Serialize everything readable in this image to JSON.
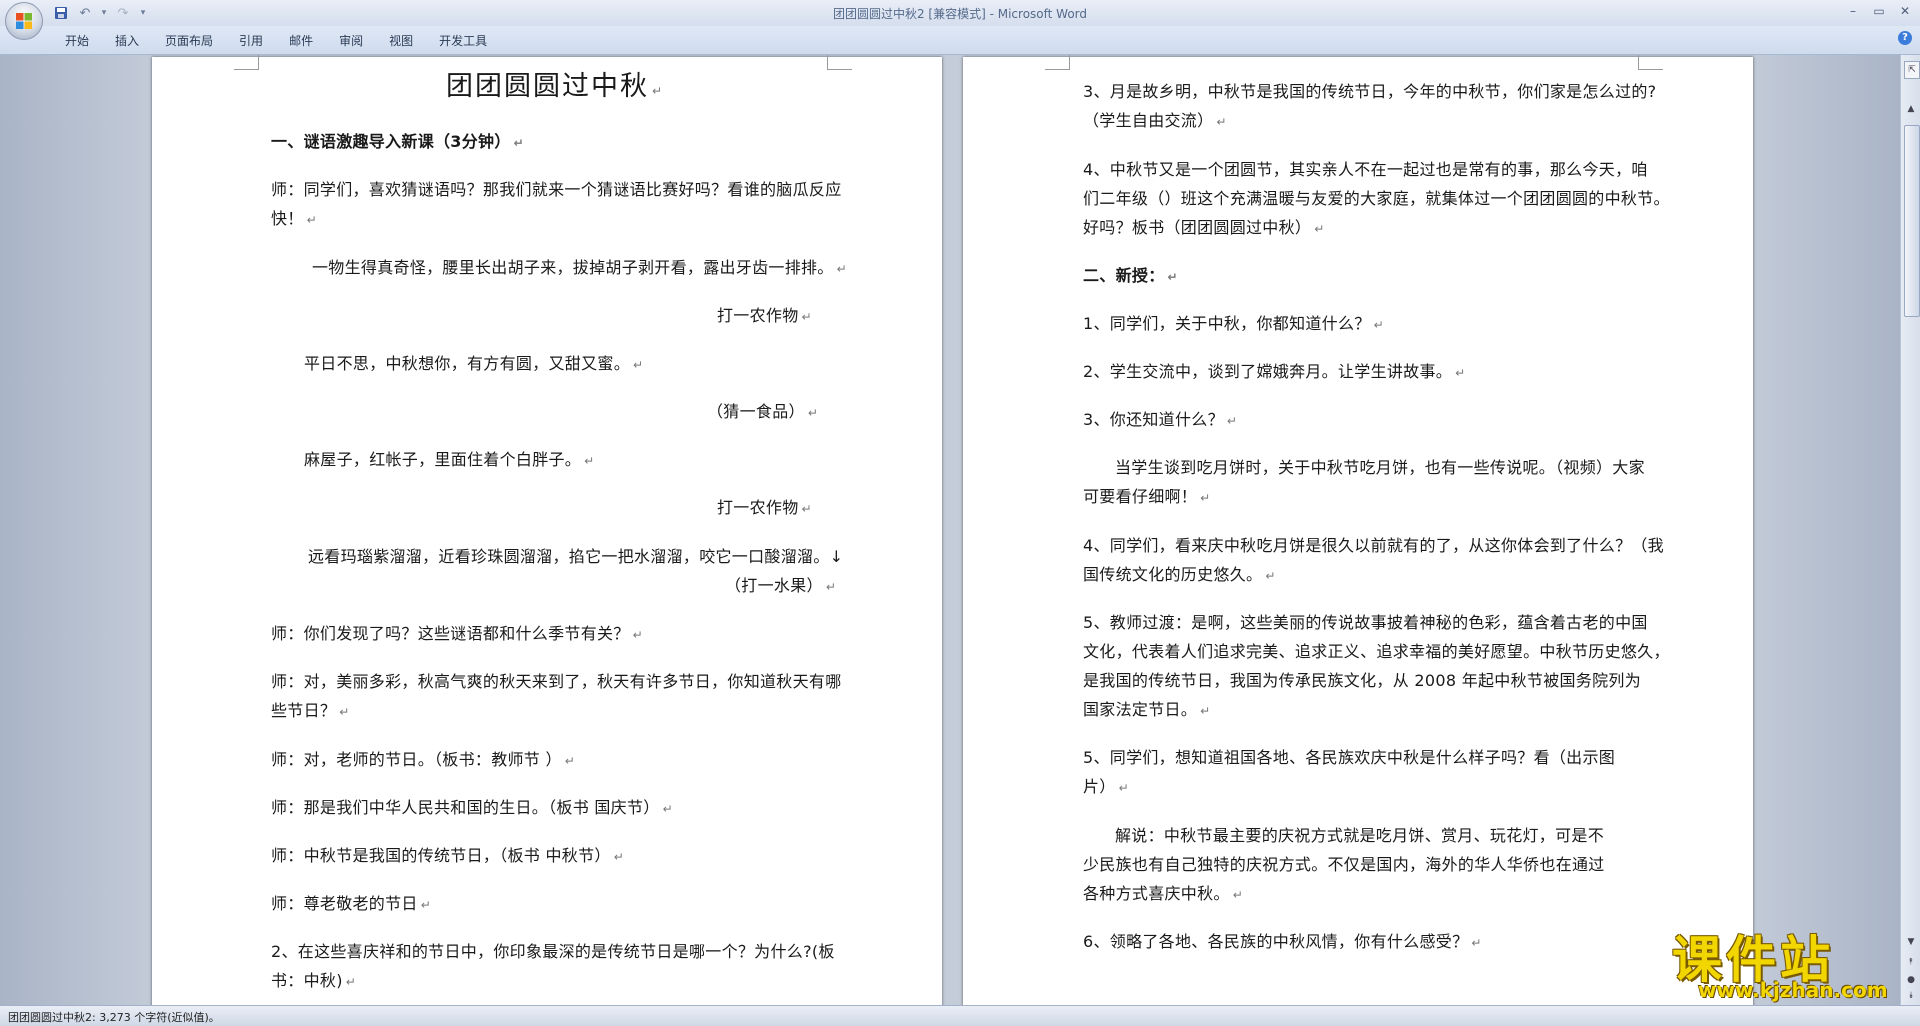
{
  "window": {
    "title": "团团圆圆过中秋2 [兼容模式] - Microsoft Word",
    "controls": {
      "minimize": "–",
      "maximize": "▭",
      "close": "✕"
    }
  },
  "quick_access": {
    "save_icon": "💾",
    "undo_icon": "↶",
    "undo_arrow": "▾",
    "redo_icon": "↷",
    "customize_icon": "▾"
  },
  "ribbon": {
    "tabs": [
      "开始",
      "插入",
      "页面布局",
      "引用",
      "邮件",
      "审阅",
      "视图",
      "开发工具"
    ],
    "help_icon": "?"
  },
  "document": {
    "page1": {
      "title": "团团圆圆过中秋",
      "paragraphs": [
        "一、谜语激趣导入新课（3分钟）",
        "师：同学们，喜欢猜谜语吗？那我们就来一个猜谜语比赛好吗？看谁的脑瓜反应",
        "快！",
        "一物生得真奇怪，腰里长出胡子来，拔掉胡子剥开看，露出牙齿一排排。",
        "打一农作物",
        "平日不思，中秋想你，有方有圆，又甜又蜜。",
        "（猜一食品）",
        "麻屋子，红帐子，里面住着个白胖子。",
        "打一农作物",
        "远看玛瑙紫溜溜，近看珍珠圆溜溜，掐它一把水溜溜，咬它一口酸溜溜。↓",
        "（打一水果）",
        "师：你们发现了吗？这些谜语都和什么季节有关？",
        "师：对，美丽多彩，秋高气爽的秋天来到了，秋天有许多节日，你知道秋天有哪",
        "些节日？",
        "师：对，老师的节日。（板书：教师节 ）",
        "师：那是我们中华人民共和国的生日。（板书    国庆节）",
        "师：中秋节是我国的传统节日，（板书 中秋节）",
        "师：尊老敬老的节日",
        "2、在这些喜庆祥和的节日中，你印象最深的是传统节日是哪一个？为什么?(板",
        "书：中秋)"
      ]
    },
    "page2": {
      "paragraphs": [
        "3、月是故乡明，中秋节是我国的传统节日，今年的中秋节，你们家是怎么过的?",
        "（学生自由交流）",
        "4、中秋节又是一个团圆节，其实亲人不在一起过也是常有的事，那么今天，咱",
        "们二年级（）班这个充满温暖与友爱的大家庭，就集体过一个团团圆圆的中秋节。",
        "好吗？板书（团团圆圆过中秋）",
        "二、新授：",
        "1、同学们，关于中秋，你都知道什么？",
        "2、学生交流中，谈到了嫦娥奔月。让学生讲故事。",
        "3、你还知道什么？",
        "当学生谈到吃月饼时，关于中秋节吃月饼，也有一些传说呢。（视频）大家",
        "可要看仔细啊！",
        "4、同学们，看来庆中秋吃月饼是很久以前就有的了，从这你体会到了什么？（我",
        "国传统文化的历史悠久。",
        "5、教师过渡：是啊，这些美丽的传说故事披着神秘的色彩，蕴含着古老的中国",
        "文化，代表着人们追求完美、追求正义、追求幸福的美好愿望。中秋节历史悠久，",
        "是我国的传统节日，我国为传承民族文化，从 2008 年起中秋节被国务院列为",
        "国家法定节日。",
        "5、同学们，想知道祖国各地、各民族欢庆中秋是什么样子吗？看（出示图",
        "片）",
        "解说：中秋节最主要的庆祝方式就是吃月饼、赏月、玩花灯，可是不",
        "少民族也有自己独特的庆祝方式。不仅是国内，海外的华人华侨也在通过",
        "各种方式喜庆中秋。",
        "6、领略了各地、各民族的中秋风情，你有什么感受？"
      ]
    }
  },
  "scrollbar": {
    "up": "▲",
    "down": "▼",
    "prev_page": "⯭",
    "browse": "●",
    "next_page": "⯯",
    "ruler": "⇱"
  },
  "status_bar": {
    "text": "团团圆圆过中秋2: 3,273 个字符(近似值)。"
  },
  "watermark": {
    "main": "课件站",
    "url": "www.kjzhan.com"
  }
}
